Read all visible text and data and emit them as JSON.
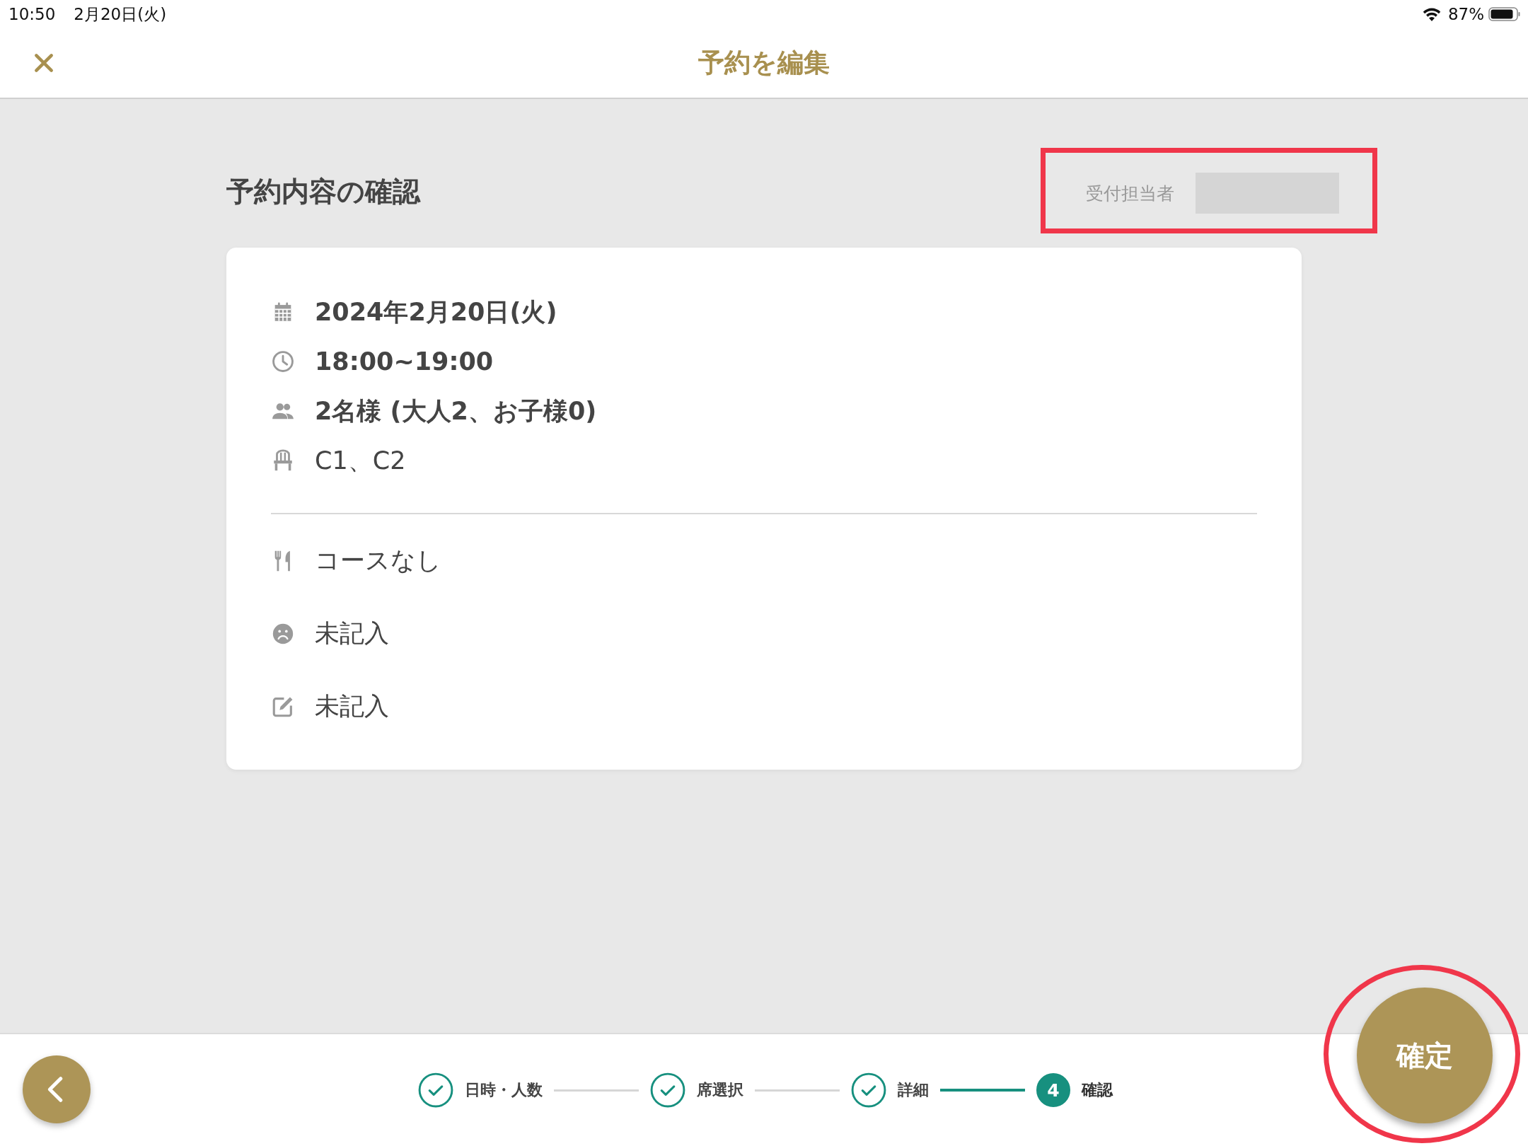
{
  "status_bar": {
    "time": "10:50",
    "date": "2月20日(火)",
    "battery": "87%"
  },
  "nav": {
    "title": "予約を編集"
  },
  "section_title": "予約内容の確認",
  "receptionist": {
    "label": "受付担当者",
    "highlighted": true
  },
  "summary": {
    "groups": [
      [
        {
          "kind": "calendar",
          "text": "2024年2月20日(火)",
          "bold": true
        },
        {
          "kind": "clock",
          "text": "18:00~19:00",
          "bold": true
        },
        {
          "kind": "people",
          "text": "2名様 (大人2、お子様0)",
          "bold": true
        },
        {
          "kind": "chair",
          "text": "C1、C2",
          "bold": false
        }
      ],
      [
        {
          "kind": "cutlery",
          "text": "コースなし",
          "bold": false
        },
        {
          "kind": "face",
          "text": "未記入",
          "bold": false
        },
        {
          "kind": "edit",
          "text": "未記入",
          "bold": false
        }
      ]
    ]
  },
  "stepper": {
    "steps": [
      {
        "label": "日時・人数",
        "done": true,
        "selected": false
      },
      {
        "label": "席選択",
        "done": true,
        "selected": false
      },
      {
        "label": "詳細",
        "done": true,
        "selected": false
      },
      {
        "label": "確認",
        "number": "4",
        "done": false,
        "selected": true
      }
    ]
  },
  "confirm_button": {
    "label": "確定",
    "highlighted": true
  }
}
